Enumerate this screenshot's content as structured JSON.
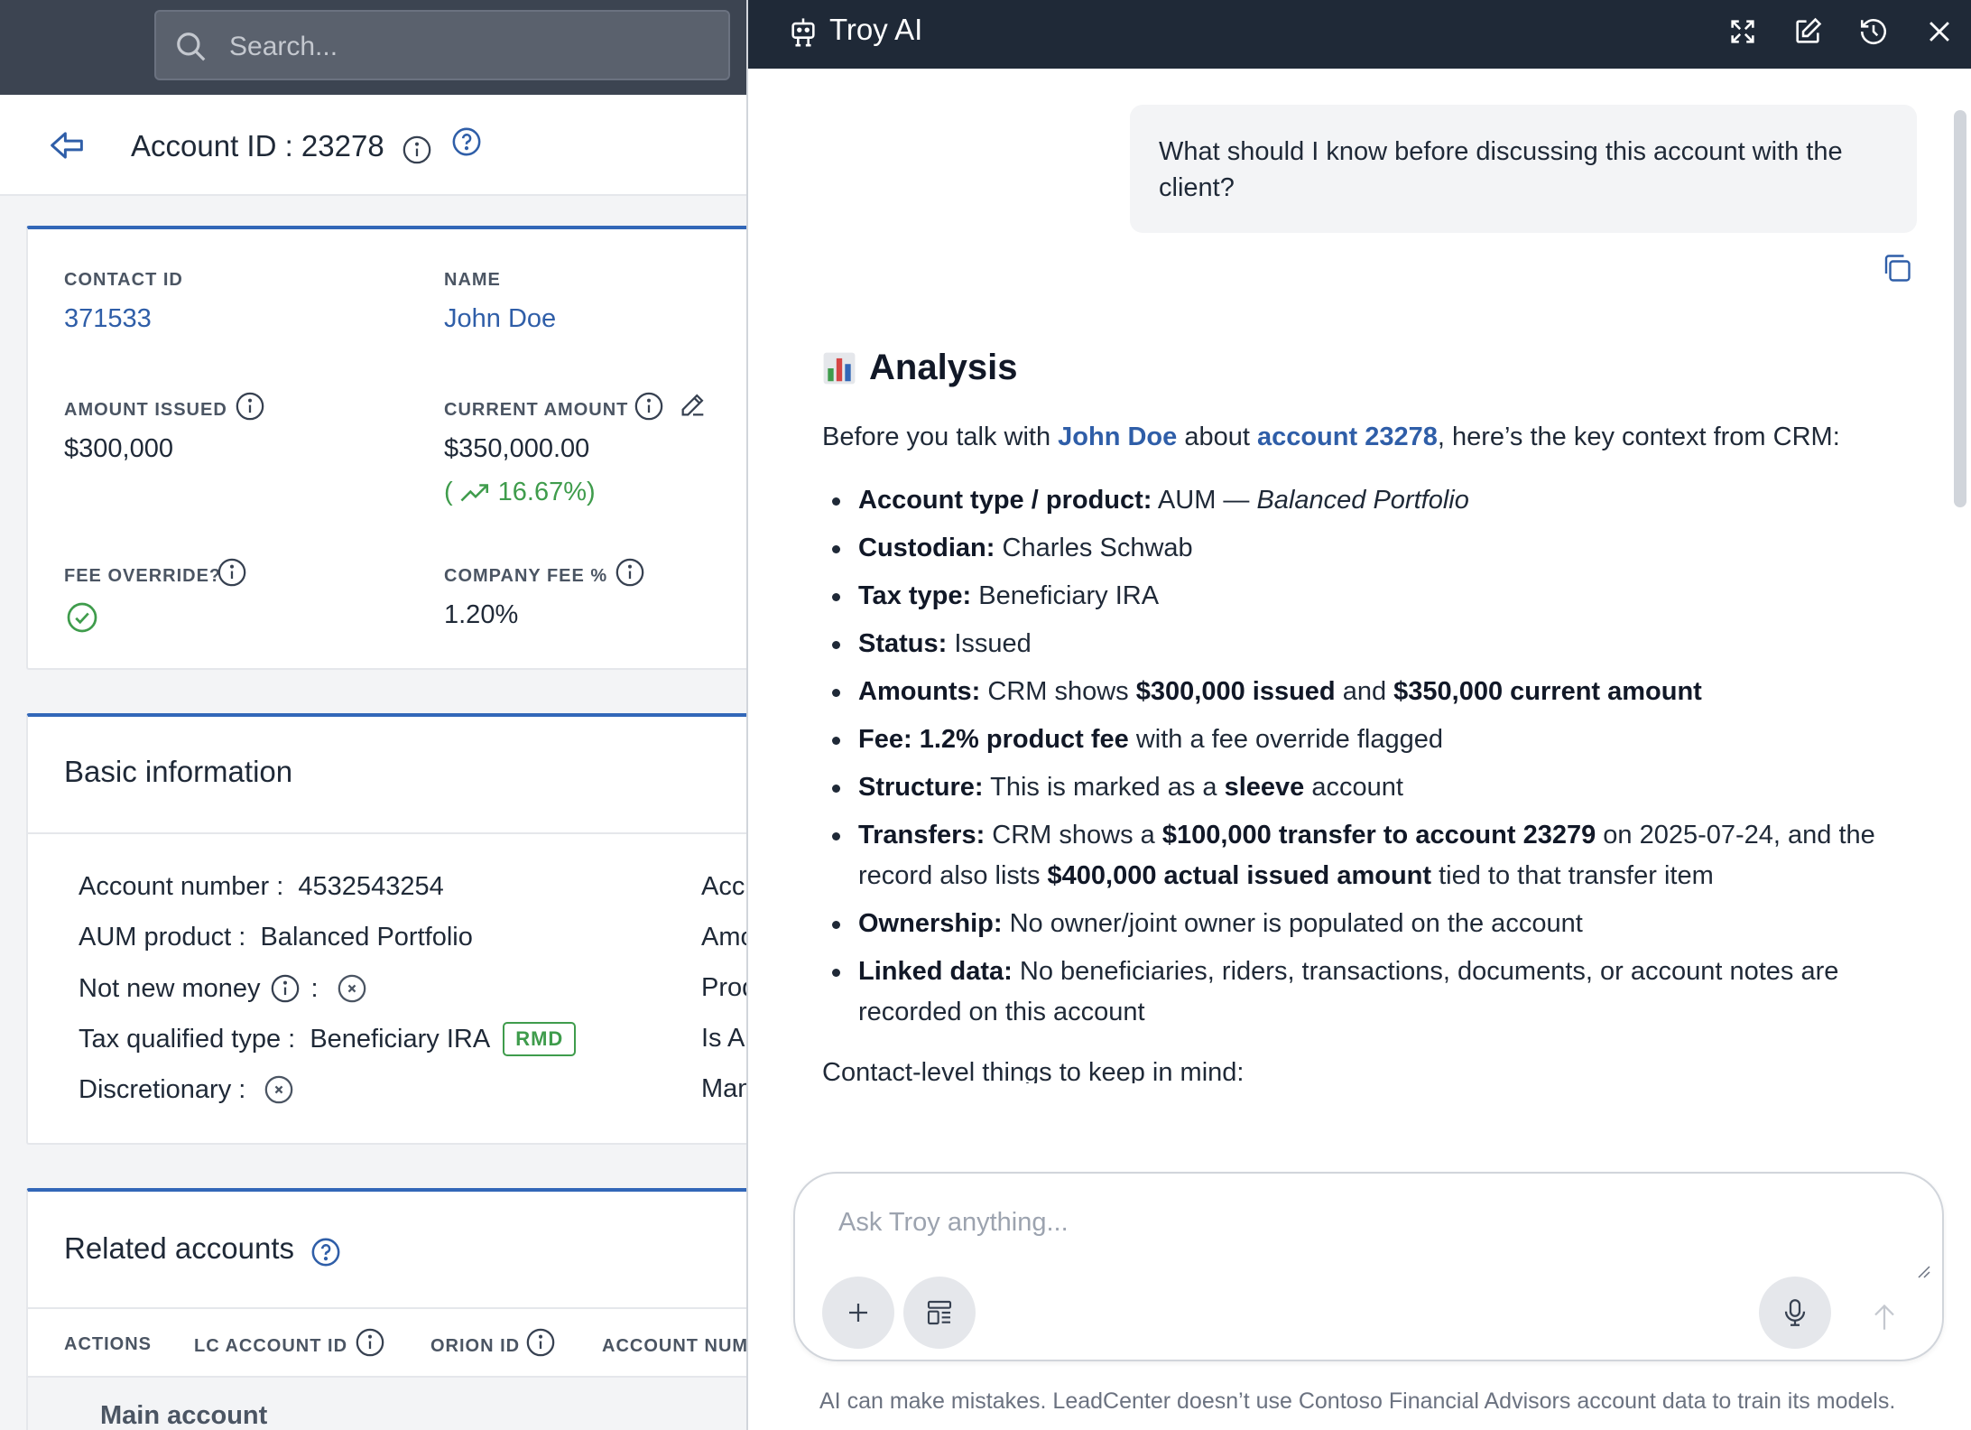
{
  "crm": {
    "search_placeholder": "Search...",
    "account_title": "Account ID : 23278",
    "summary": {
      "contact_id_label": "CONTACT ID",
      "contact_id": "371533",
      "name_label": "NAME",
      "name": "John Doe",
      "amount_issued_label": "AMOUNT ISSUED",
      "amount_issued": "$300,000",
      "current_amount_label": "CURRENT AMOUNT",
      "current_amount": "$350,000.00",
      "change_open": "(",
      "change_pct": "16.67%)",
      "fee_override_label": "FEE OVERRIDE?",
      "company_fee_label": "COMPANY FEE %",
      "company_fee": "1.20%"
    },
    "basic_info": {
      "title": "Basic information",
      "account_number_label": "Account number :",
      "account_number": "4532543254",
      "aum_product_label": "AUM product :",
      "aum_product": "Balanced Portfolio",
      "not_new_money_label": "Not new money",
      "colon": ":",
      "tax_type_label": "Tax qualified type :",
      "tax_type": "Beneficiary IRA",
      "rmd_badge": "RMD",
      "discretionary_label": "Discretionary :",
      "right_col": [
        "Acc",
        "Amo",
        "Prod",
        "Is A",
        "Man"
      ]
    },
    "related": {
      "title": "Related accounts",
      "columns": [
        "ACTIONS",
        "LC ACCOUNT ID",
        "ORION ID",
        "ACCOUNT NUM"
      ],
      "first_row": "Main account"
    }
  },
  "ai": {
    "title": "Troy AI",
    "user_message": "What should I know before discussing this account with the client?",
    "answer_heading": "Analysis",
    "intro_before": "Before you talk with ",
    "intro_name": "John Doe",
    "intro_mid": " about ",
    "intro_account": "account 23278",
    "intro_after": ", here’s the key context from CRM:",
    "bullets": [
      {
        "label": "Account type / product:",
        "parts": [
          {
            "t": " AUM — "
          },
          {
            "i": "Balanced Portfolio"
          }
        ]
      },
      {
        "label": "Custodian:",
        "parts": [
          {
            "t": " Charles Schwab"
          }
        ]
      },
      {
        "label": "Tax type:",
        "parts": [
          {
            "t": " Beneficiary IRA"
          }
        ]
      },
      {
        "label": "Status:",
        "parts": [
          {
            "t": " Issued"
          }
        ]
      },
      {
        "label": "Amounts:",
        "parts": [
          {
            "t": " CRM shows "
          },
          {
            "b": "$300,000 issued"
          },
          {
            "t": " and "
          },
          {
            "b": "$350,000 current amount"
          }
        ]
      },
      {
        "label": "Fee:",
        "parts": [
          {
            "t": " "
          },
          {
            "b": "1.2% product fee"
          },
          {
            "t": " with a fee override flagged"
          }
        ]
      },
      {
        "label": "Structure:",
        "parts": [
          {
            "t": " This is marked as a "
          },
          {
            "b": "sleeve"
          },
          {
            "t": " account"
          }
        ]
      },
      {
        "label": "Transfers:",
        "parts": [
          {
            "t": " CRM shows a "
          },
          {
            "b": "$100,000 transfer to account 23279"
          },
          {
            "t": " on 2025-07-24, and the record also lists "
          },
          {
            "b": "$400,000 actual issued amount"
          },
          {
            "t": " tied to that transfer item"
          }
        ]
      },
      {
        "label": "Ownership:",
        "parts": [
          {
            "t": " No owner/joint owner is populated on the account"
          }
        ]
      },
      {
        "label": "Linked data:",
        "parts": [
          {
            "t": " No beneficiaries, riders, transactions, documents, or account notes are recorded on this account"
          }
        ]
      }
    ],
    "contact_line": "Contact-level things to keep in mind:",
    "composer_placeholder": "Ask Troy anything...",
    "disclaimer": "AI can make mistakes. LeadCenter doesn’t use Contoso Financial Advisors account data to train its models."
  }
}
